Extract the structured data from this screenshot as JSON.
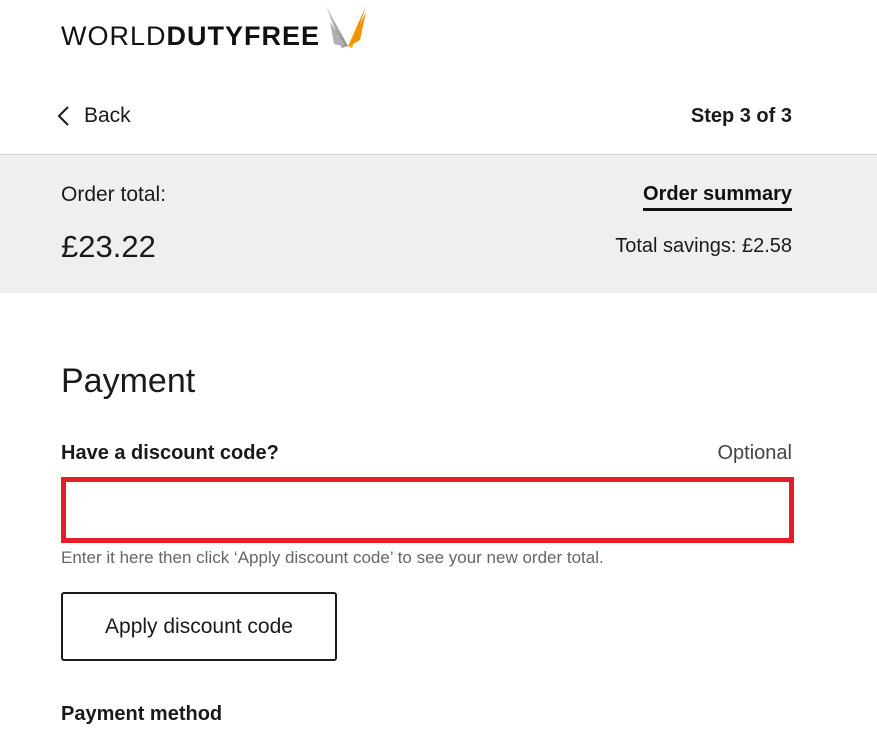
{
  "header": {
    "logo_text_regular": "WORLD",
    "logo_text_bold": "DUTYFREE",
    "logo_icon": "butterfly-logo-icon"
  },
  "nav": {
    "back_label": "Back",
    "back_icon": "chevron-left-icon",
    "step_label": "Step 3 of 3"
  },
  "summary": {
    "order_total_label": "Order total:",
    "order_total_value": "£23.22",
    "order_summary_link": "Order summary",
    "total_savings": "Total savings: £2.58"
  },
  "payment": {
    "title": "Payment",
    "discount_label": "Have a discount code?",
    "optional_label": "Optional",
    "discount_input_value": "",
    "discount_input_placeholder": "",
    "hint": "Enter it here then click ‘Apply discount code’ to see your new order total.",
    "apply_button_label": "Apply discount code",
    "payment_method_label": "Payment method"
  },
  "colors": {
    "input_border_error": "#e41d26",
    "summary_band_bg": "#efefef",
    "logo_orange": "#f39200"
  }
}
